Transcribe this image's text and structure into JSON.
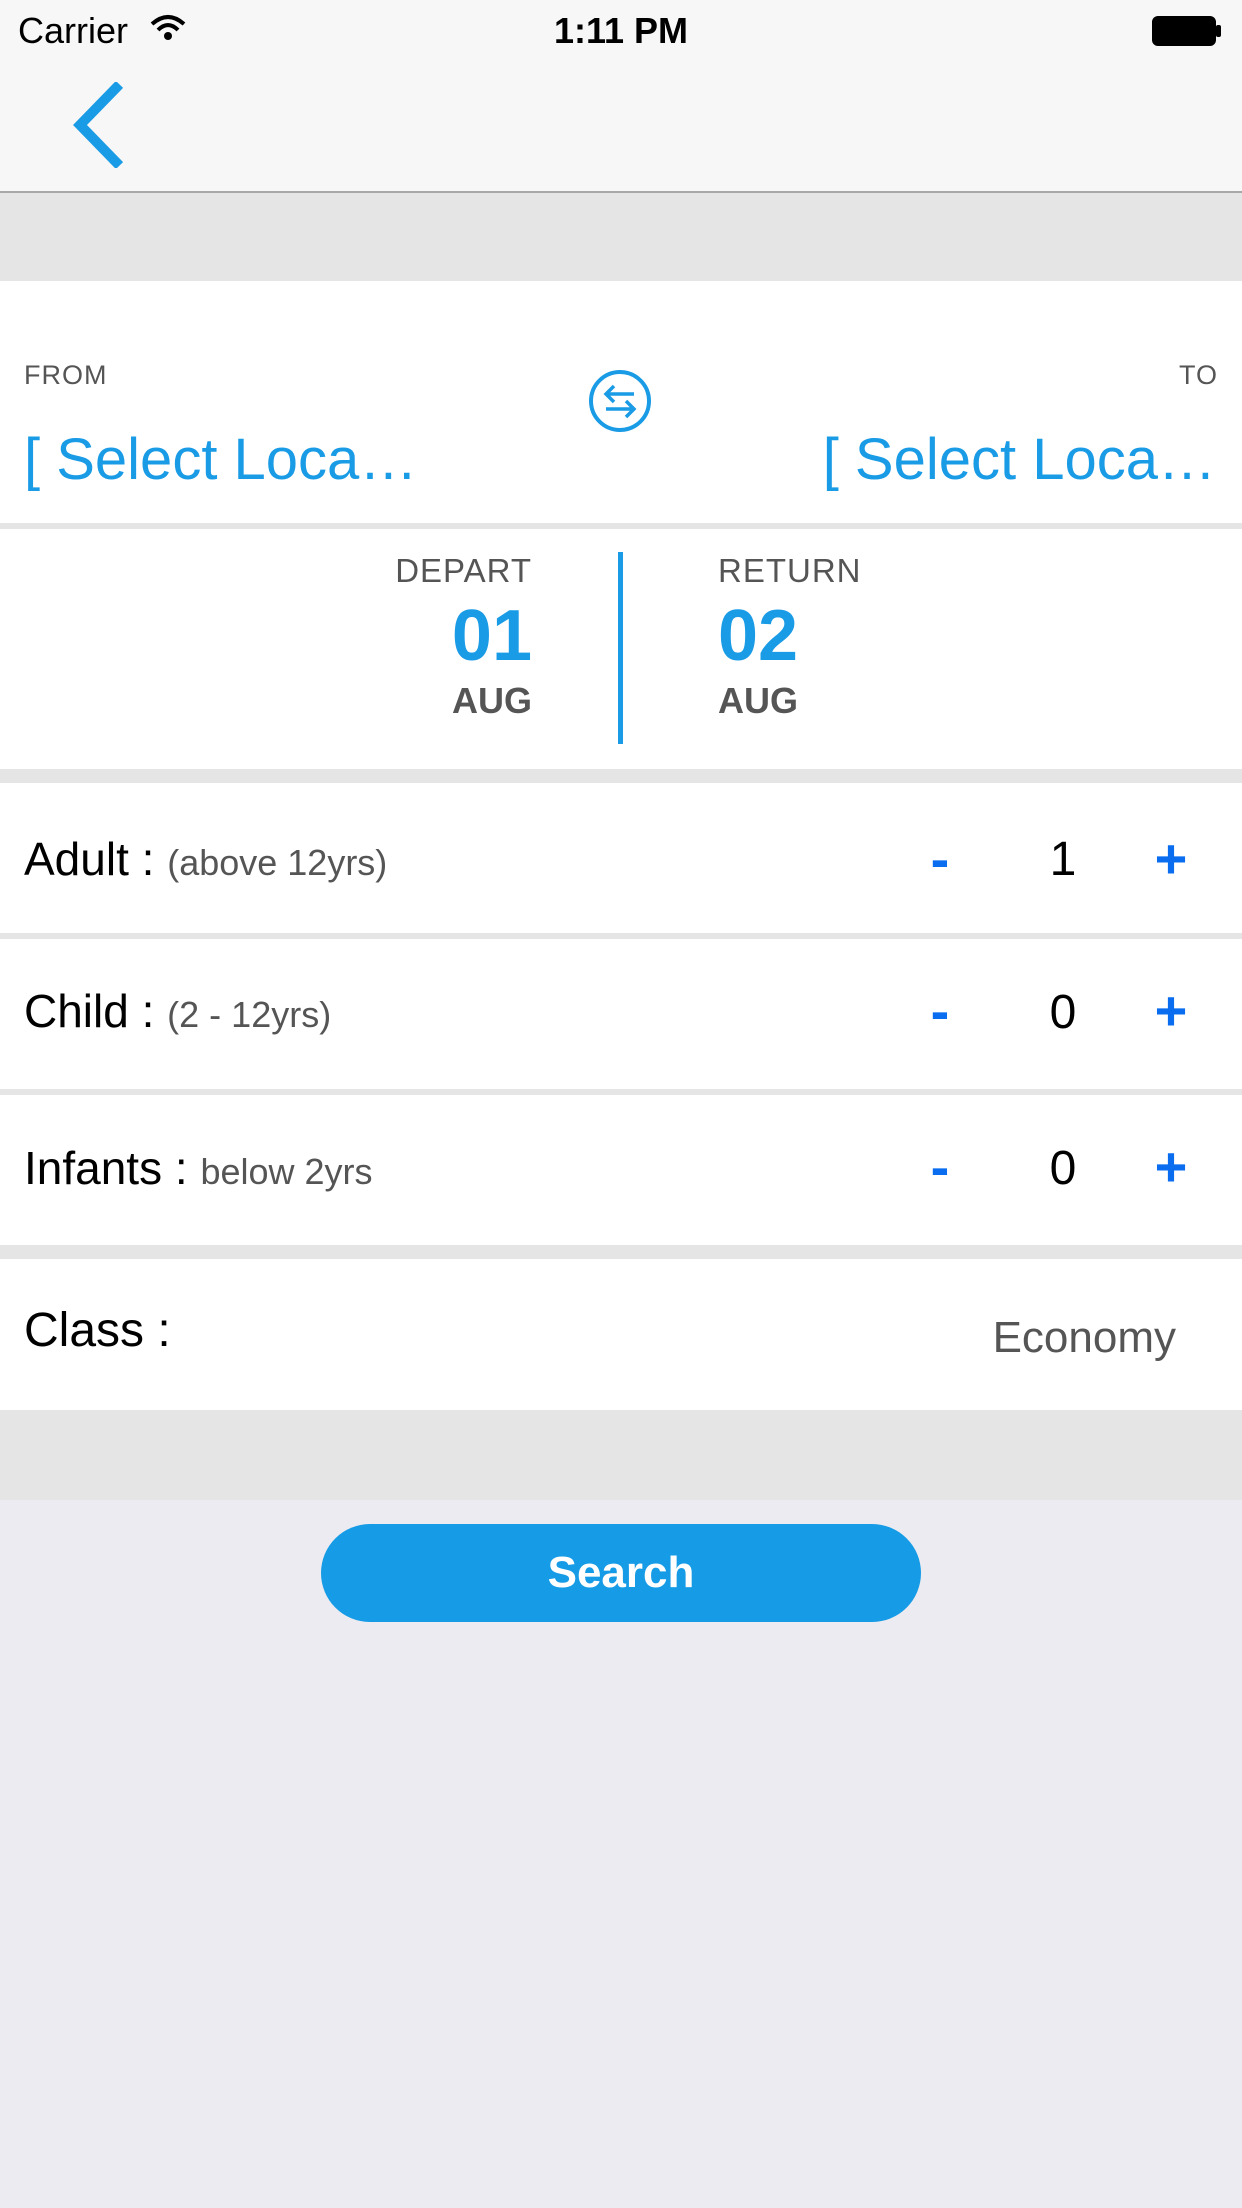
{
  "status_bar": {
    "carrier": "Carrier",
    "time": "1:11 PM"
  },
  "nav": {
    "back_icon": "chevron-left-icon"
  },
  "route": {
    "from_label": "FROM",
    "to_label": "TO",
    "from_value": "[ Select Loca…",
    "to_value": "[ Select Loca…",
    "swap_icon": "swap-arrows-icon"
  },
  "dates": {
    "depart_label": "DEPART",
    "depart_day": "01",
    "depart_month": "AUG",
    "return_label": "RETURN",
    "return_day": "02",
    "return_month": "AUG"
  },
  "passengers": {
    "adult": {
      "label": "Adult : ",
      "sub": "(above 12yrs)",
      "count": "1"
    },
    "child": {
      "label": "Child : ",
      "sub": "(2 - 12yrs)",
      "count": "0"
    },
    "infant": {
      "label": "Infants : ",
      "sub": "below 2yrs",
      "count": "0"
    },
    "minus_symbol": "-",
    "plus_symbol": "+"
  },
  "travel_class": {
    "label": "Class :",
    "value": "Economy"
  },
  "search_button": "Search",
  "colors": {
    "accent": "#1a9be6",
    "stepper": "#0a6df0",
    "button": "#169be6",
    "background": "#ebebf1"
  }
}
